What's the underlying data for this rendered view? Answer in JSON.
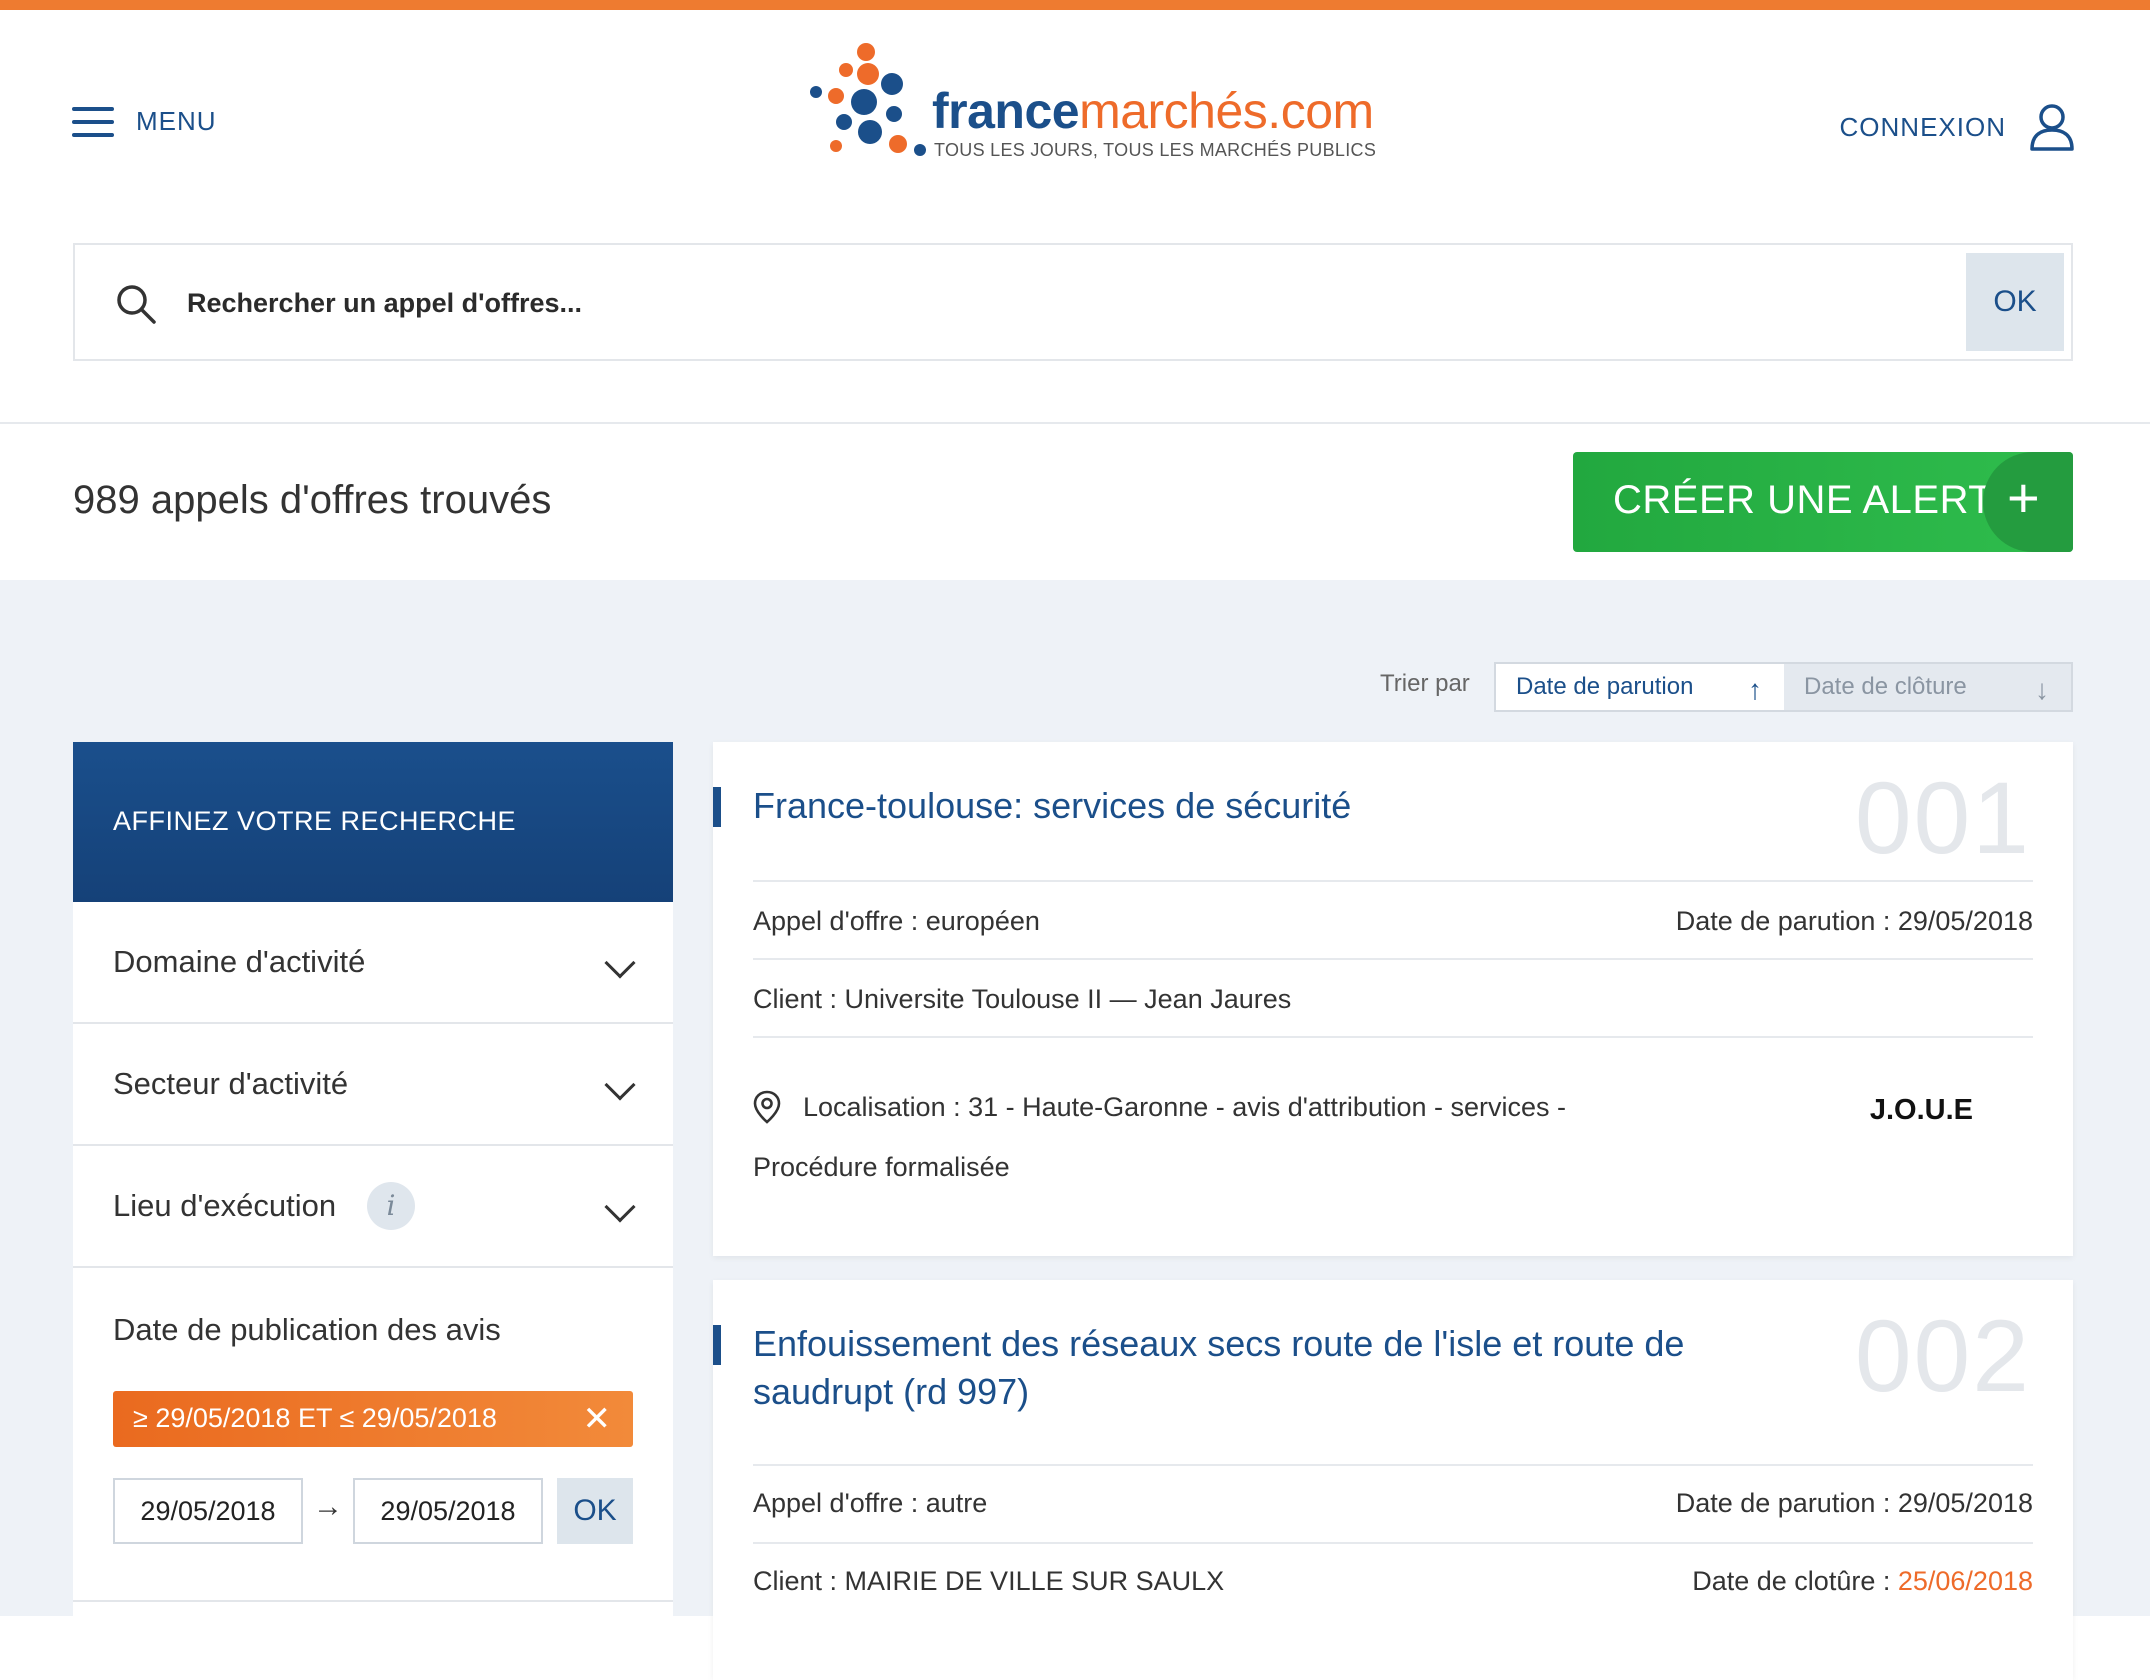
{
  "header": {
    "menu_label": "MENU",
    "logo_word_a": "france",
    "logo_word_b": "marchés.com",
    "logo_tagline": "TOUS LES JOURS, TOUS LES MARCHÉS PUBLICS",
    "login_label": "CONNEXION"
  },
  "search": {
    "placeholder": "Rechercher un appel d'offres...",
    "value": "",
    "submit_label": "OK"
  },
  "results": {
    "count_text": "989 appels d'offres trouvés",
    "create_alert_label": "CRÉER UNE ALERTE",
    "create_alert_icon": "+"
  },
  "sort": {
    "label": "Trier par",
    "options": [
      {
        "label": "Date de parution",
        "icon": "↑",
        "active": true
      },
      {
        "label": "Date de clôture",
        "icon": "↓",
        "active": false
      }
    ]
  },
  "sidebar": {
    "title": "AFFINEZ VOTRE RECHERCHE",
    "filters": [
      {
        "label": "Domaine d'activité"
      },
      {
        "label": "Secteur d'activité"
      },
      {
        "label": "Lieu d'exécution",
        "info": "i"
      }
    ],
    "date_filter": {
      "title": "Date de publication des avis",
      "chip_label": "≥ 29/05/2018 ET ≤ 29/05/2018",
      "chip_close": "✕",
      "from": "29/05/2018",
      "arrow": "→",
      "to": "29/05/2018",
      "ok_label": "OK"
    }
  },
  "cards": [
    {
      "title": "France-toulouse: services de sécurité",
      "number": "001",
      "type_text": "Appel d'offre : européen",
      "pub_date_text": "Date de parution : 29/05/2018",
      "client_text": "Client : Universite Toulouse II — Jean Jaures",
      "location_text": "Localisation : 31 - Haute-Garonne   - avis d'attribution  - services  -",
      "procedure_text": "Procédure formalisée",
      "source": "J.O.U.E"
    },
    {
      "title": "Enfouissement des réseaux secs route de l'isle et route de saudrupt (rd 997)",
      "number": "002",
      "type_text": "Appel d'offre : autre",
      "pub_date_text": "Date de parution : 29/05/2018",
      "client_text": "Client : MAIRIE DE VILLE SUR SAULX",
      "close_label": "Date de clotûre : ",
      "close_date": "25/06/2018"
    }
  ],
  "colors": {
    "brand_blue": "#1b4f8a",
    "brand_orange": "#ee6b2a",
    "alert_green": "#2fbd4d",
    "content_bg": "#eef2f7"
  },
  "icons": {
    "menu": "hamburger-icon",
    "user": "user-icon",
    "search": "search-icon",
    "location": "location-pin-icon",
    "chevron": "chevron-down-icon",
    "info": "info-icon",
    "close": "close-icon"
  }
}
